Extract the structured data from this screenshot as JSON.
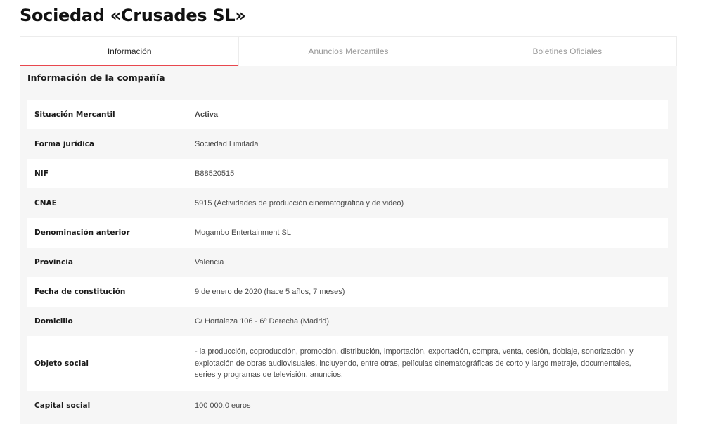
{
  "page": {
    "title": "Sociedad «Crusades SL»"
  },
  "tabs": [
    {
      "label": "Información",
      "active": true
    },
    {
      "label": "Anuncios Mercantiles",
      "active": false
    },
    {
      "label": "Boletines Oficiales",
      "active": false
    }
  ],
  "section": {
    "title": "Información de la compañía"
  },
  "rows": [
    {
      "label": "Situación Mercantil",
      "value": "Activa",
      "value_color": "#2ea043"
    },
    {
      "label": "Forma jurídica",
      "value": "Sociedad Limitada"
    },
    {
      "label": "NIF",
      "value": "B88520515"
    },
    {
      "label": "CNAE",
      "value": "5915 (Actividades de producción cinematográfica y de video)"
    },
    {
      "label": "Denominación anterior",
      "value": "Mogambo Entertainment SL"
    },
    {
      "label": "Provincia",
      "value": "Valencia"
    },
    {
      "label": "Fecha de constitución",
      "value": "9 de enero de 2020 (hace 5 años, 7 meses)"
    },
    {
      "label": "Domicilio",
      "value": "C/ Hortaleza 106 - 6º Derecha (Madrid)"
    },
    {
      "label": "Objeto social",
      "value": "- la producción, coproducción, promoción, distribución, importación, exportación, compra, venta, cesión, doblaje, sonorización, y explotación de obras audiovisuales, incluyendo, entre otras, películas cinematográficas de corto y largo metraje, documentales, series y programas de televisión, anuncios."
    },
    {
      "label": "Capital social",
      "value": "100 000,0 euros"
    }
  ],
  "colors": {
    "accent": "#e8474e",
    "active_status": "#2ea043"
  }
}
